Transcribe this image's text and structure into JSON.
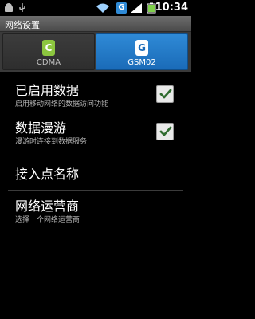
{
  "status_bar": {
    "time": "10:34",
    "icons": [
      "android-icon",
      "usb-icon",
      "wifi-icon",
      "sim-g-icon",
      "signal-icon",
      "battery-icon"
    ]
  },
  "window": {
    "title": "网络设置"
  },
  "sim_tabs": {
    "cdma": {
      "badge": "C",
      "label": "CDMA"
    },
    "gsm": {
      "badge": "G",
      "label": "GSM02",
      "selected": true
    }
  },
  "settings": {
    "data_enabled": {
      "title": "已启用数据",
      "subtitle": "启用移动网络的数据访问功能",
      "checked": true
    },
    "data_roaming": {
      "title": "数据漫游",
      "subtitle": "漫游时连接到数据服务",
      "checked": true
    },
    "apn": {
      "title": "接入点名称"
    },
    "operators": {
      "title": "网络运营商",
      "subtitle": "选择一个网络运营商"
    }
  },
  "colors": {
    "accent_blue": "#1a6bb8",
    "cdma_green": "#8cc63f",
    "check_green": "#2f6b2f"
  }
}
